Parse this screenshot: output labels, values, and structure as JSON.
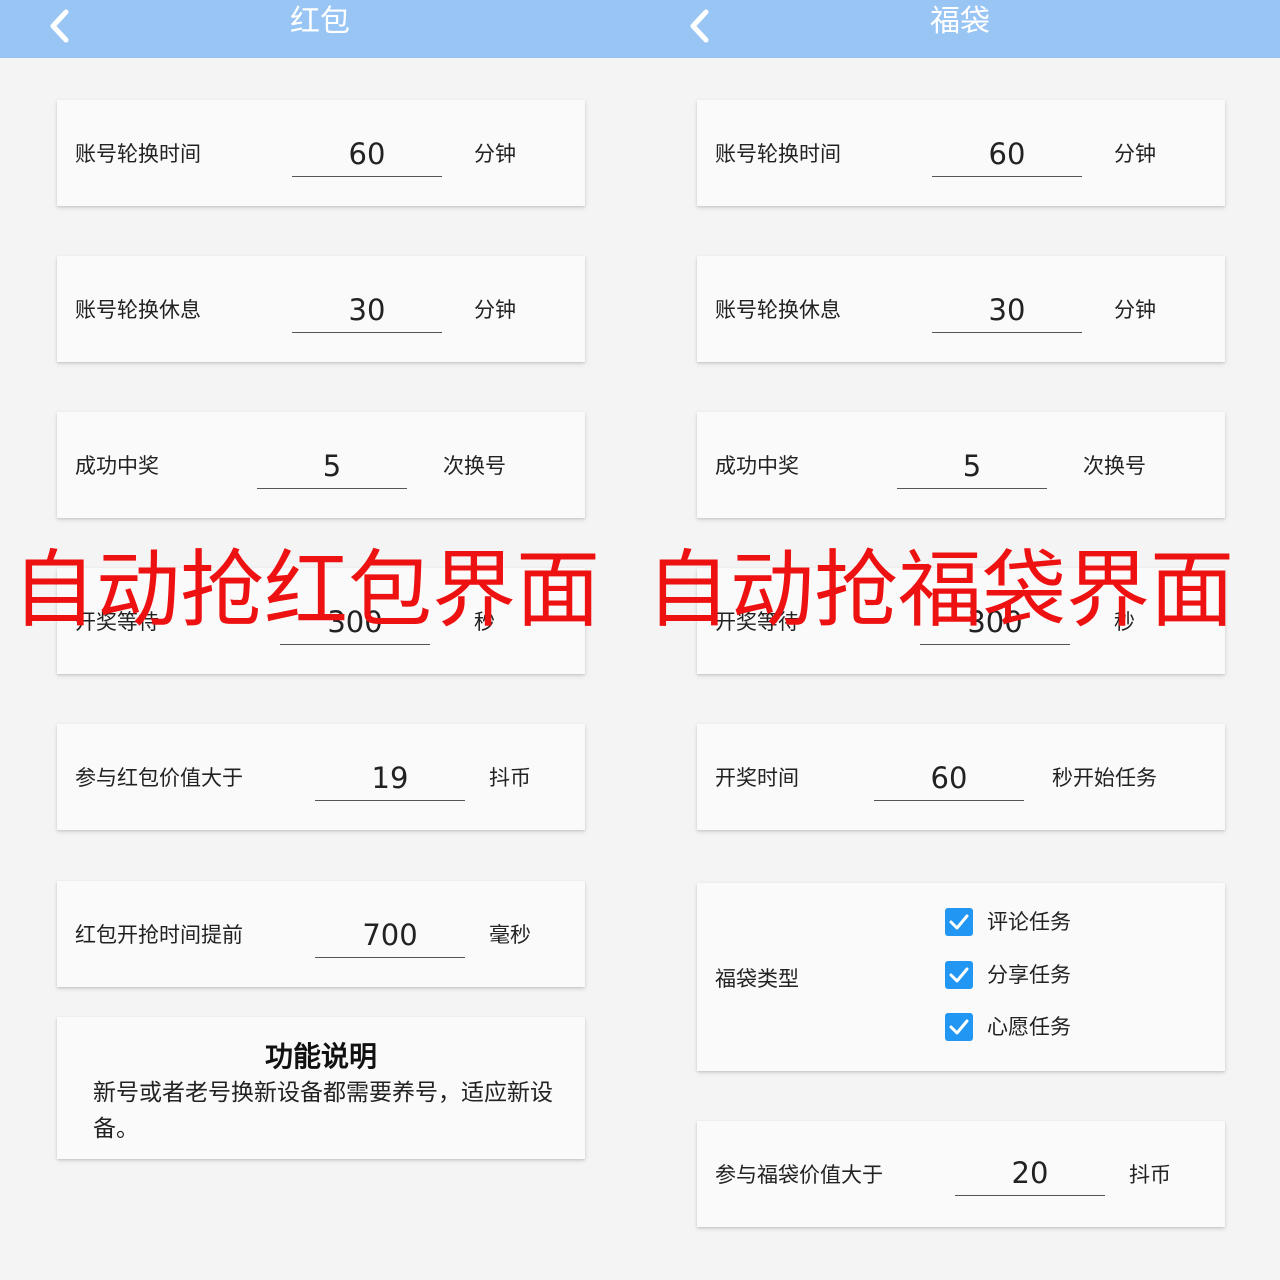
{
  "colors": {
    "appbar": "#99c5f5",
    "card": "#fafafa",
    "background": "#f4f4f4",
    "checkbox": "#2196f3",
    "overlay_text": "#ee1111"
  },
  "red_packet": {
    "title": "红包",
    "back_icon": "chevron-left-icon",
    "rows": [
      {
        "label": "账号轮换时间",
        "value": "60",
        "unit": "分钟"
      },
      {
        "label": "账号轮换休息",
        "value": "30",
        "unit": "分钟"
      },
      {
        "label": "成功中奖",
        "value": "5",
        "unit": "次换号"
      },
      {
        "label": "开奖等待",
        "value": "300",
        "unit": "秒"
      },
      {
        "label": "参与红包价值大于",
        "value": "19",
        "unit": "抖币"
      },
      {
        "label": "红包开抢时间提前",
        "value": "700",
        "unit": "毫秒"
      }
    ],
    "info": {
      "title": "功能说明",
      "body": "新号或者老号换新设备都需要养号，适应新设备。"
    }
  },
  "lucky_bag": {
    "title": "福袋",
    "back_icon": "chevron-left-icon",
    "rows": [
      {
        "label": "账号轮换时间",
        "value": "60",
        "unit": "分钟"
      },
      {
        "label": "账号轮换休息",
        "value": "30",
        "unit": "分钟"
      },
      {
        "label": "成功中奖",
        "value": "5",
        "unit": "次换号"
      },
      {
        "label": "开奖等待",
        "value": "300",
        "unit": "秒"
      },
      {
        "label": "开奖时间",
        "value": "60",
        "unit": "秒开始任务"
      }
    ],
    "type_label": "福袋类型",
    "type_options": [
      {
        "label": "评论任务",
        "checked": true
      },
      {
        "label": "分享任务",
        "checked": true
      },
      {
        "label": "心愿任务",
        "checked": true
      }
    ],
    "value_row": {
      "label": "参与福袋价值大于",
      "value": "20",
      "unit": "抖币"
    }
  },
  "overlay": {
    "left": "自动抢红包界面",
    "right": "自动抢福袋界面"
  }
}
